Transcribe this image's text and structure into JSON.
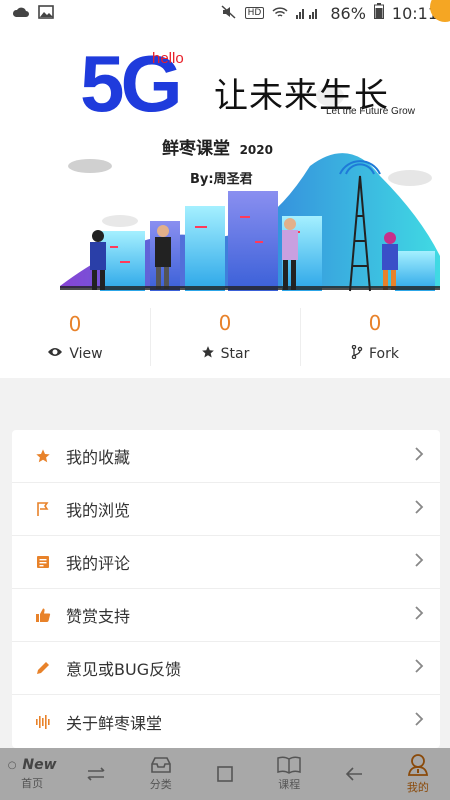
{
  "status_bar": {
    "battery": "86%",
    "time": "10:11",
    "network_tag": "HD"
  },
  "banner": {
    "five_g": "5G",
    "hello": "hello",
    "slogan": "让未来生长",
    "slogan_en": "Let the Future Grow",
    "app_name": "鲜枣课堂",
    "year": "2020",
    "byline": "By:周圣君"
  },
  "stats": [
    {
      "value": "0",
      "label": "View",
      "icon": "eye-icon"
    },
    {
      "value": "0",
      "label": "Star",
      "icon": "star-icon"
    },
    {
      "value": "0",
      "label": "Fork",
      "icon": "fork-icon"
    }
  ],
  "menu": [
    {
      "label": "我的收藏",
      "icon": "star-icon"
    },
    {
      "label": "我的浏览",
      "icon": "flag-icon"
    },
    {
      "label": "我的评论",
      "icon": "comment-icon"
    },
    {
      "label": "赞赏支持",
      "icon": "thumbs-up-icon"
    },
    {
      "label": "意见或BUG反馈",
      "icon": "pencil-icon"
    },
    {
      "label": "关于鲜枣课堂",
      "icon": "audio-wave-icon"
    }
  ],
  "nav": [
    {
      "label": "首页",
      "badge": "New"
    },
    {
      "label": ""
    },
    {
      "label": "分类"
    },
    {
      "label": ""
    },
    {
      "label": "课程"
    },
    {
      "label": ""
    },
    {
      "label": "我的"
    }
  ],
  "colors": {
    "accent": "#e8822a",
    "blue": "#1f3bdc",
    "red": "#e8202a"
  }
}
